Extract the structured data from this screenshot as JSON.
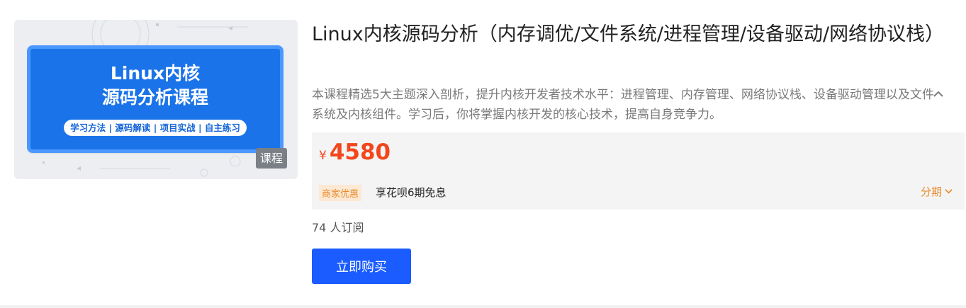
{
  "course": {
    "cover": {
      "title_line1": "Linux内核",
      "title_line2": "源码分析课程",
      "pill": "学习方法 | 源码解读 | 项目实战 | 自主练习",
      "tag": "课程"
    },
    "title": "Linux内核源码分析（内存调优/文件系统/进程管理/设备驱动/网络协议栈）",
    "description": "本课程精选5大主题深入剖析，提升内核开发者技术水平：进程管理、内存管理、网络协议栈、设备驱动管理以及文件系统及内核组件。学习后，你将掌握内核开发的核心技术，提高自身竞争力。",
    "price": {
      "currency": "¥",
      "amount": "4580"
    },
    "promo": {
      "badge": "商家优惠",
      "text": "享花呗6期免息",
      "installment_label": "分期"
    },
    "subscribers": "74 人订阅",
    "buy_label": "立即购买"
  },
  "colors": {
    "price": "#f2461c",
    "buy_button": "#1a5cff",
    "promo": "#e88a2a",
    "cover_blue": "#1a73e8"
  },
  "icons": {
    "collapse": "chevron-up-icon",
    "installment": "chevron-down-icon"
  }
}
